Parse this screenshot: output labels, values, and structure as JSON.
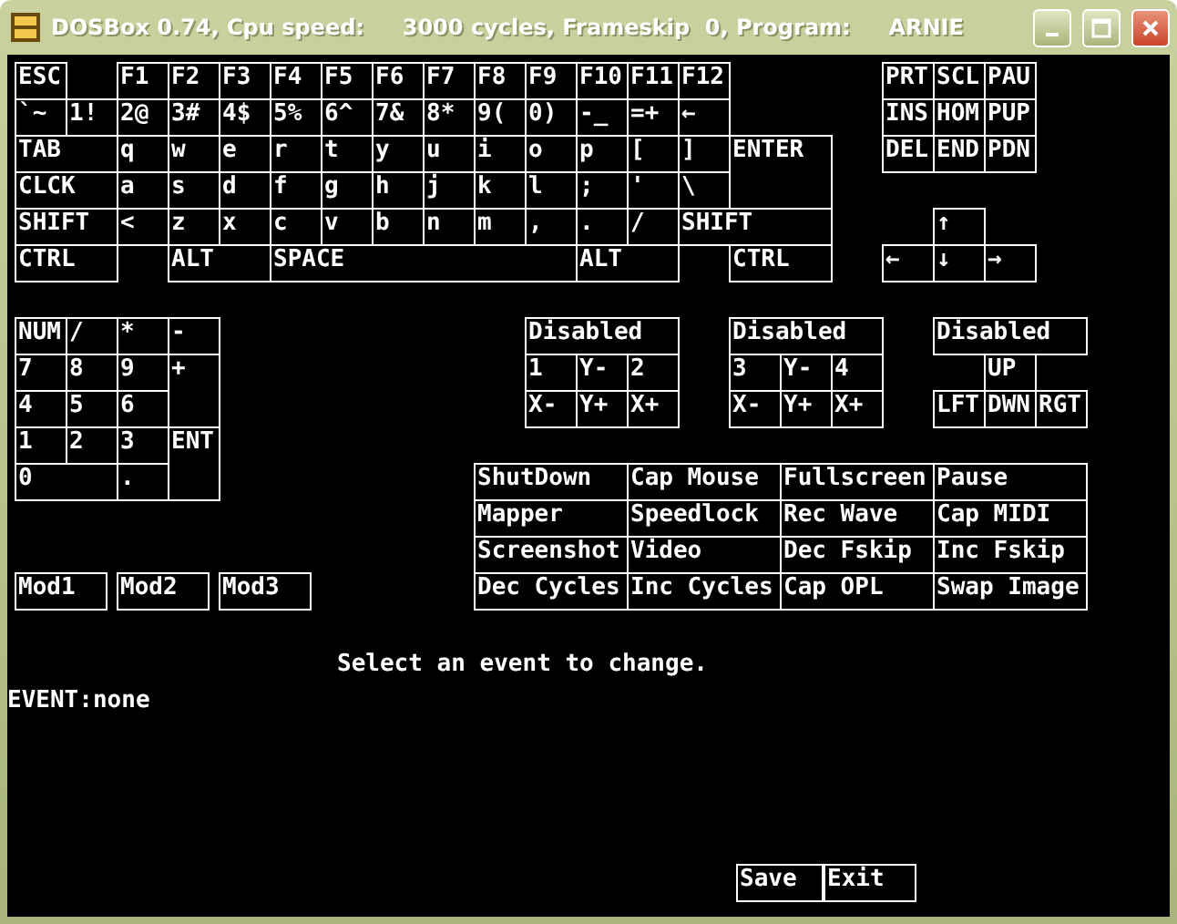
{
  "window": {
    "title": "DOSBox 0.74, Cpu speed:     3000 cycles, Frameskip  0, Program:     ARNIE"
  },
  "keyboard": [
    [
      "ESC",
      "F1",
      "F2",
      "F3",
      "F4",
      "F5",
      "F6",
      "F7",
      "F8",
      "F9",
      "F10",
      "F11",
      "F12"
    ],
    [
      "`~",
      "1!",
      "2@",
      "3#",
      "4$",
      "5%",
      "6^",
      "7&",
      "8*",
      "9(",
      "0)",
      "-_",
      "=+",
      "←"
    ],
    [
      "TAB",
      "q",
      "w",
      "e",
      "r",
      "t",
      "y",
      "u",
      "i",
      "o",
      "p",
      "[",
      "]",
      "ENTER"
    ],
    [
      "CLCK",
      "a",
      "s",
      "d",
      "f",
      "g",
      "h",
      "j",
      "k",
      "l",
      ";",
      "'",
      "\\"
    ],
    [
      "SHIFT",
      "<",
      "z",
      "x",
      "c",
      "v",
      "b",
      "n",
      "m",
      ",",
      ".",
      "/",
      "SHIFT"
    ],
    [
      "CTRL",
      "ALT",
      "SPACE",
      "ALT",
      "CTRL"
    ]
  ],
  "nav_keys": [
    "PRT",
    "SCL",
    "PAU",
    "INS",
    "HOM",
    "PUP",
    "DEL",
    "END",
    "PDN"
  ],
  "arrow_keys": [
    "↑",
    "←",
    "↓",
    "→"
  ],
  "numpad": [
    "NUM",
    "/",
    "*",
    "-",
    "7",
    "8",
    "9",
    "+",
    "4",
    "5",
    "6",
    "1",
    "2",
    "3",
    "ENT",
    "0",
    "."
  ],
  "joysticks": [
    {
      "mode": "Disabled",
      "buttons": [
        "1",
        "Y-",
        "2",
        "X-",
        "Y+",
        "X+"
      ]
    },
    {
      "mode": "Disabled",
      "buttons": [
        "3",
        "Y-",
        "4",
        "X-",
        "Y+",
        "X+"
      ]
    },
    {
      "mode": "Disabled",
      "buttons": [
        "UP",
        "LFT",
        "DWN",
        "RGT"
      ]
    }
  ],
  "events": [
    "ShutDown",
    "Cap Mouse",
    "Fullscreen",
    "Pause",
    "Mapper",
    "Speedlock",
    "Rec Wave",
    "Cap MIDI",
    "Screenshot",
    "Video",
    "Dec Fskip",
    "Inc Fskip",
    "Dec Cycles",
    "Inc Cycles",
    "Cap OPL",
    "Swap Image"
  ],
  "mods": [
    "Mod1",
    "Mod2",
    "Mod3"
  ],
  "message": "Select an event to change.",
  "event_line": "EVENT:none",
  "buttons": [
    "Save",
    "Exit"
  ]
}
